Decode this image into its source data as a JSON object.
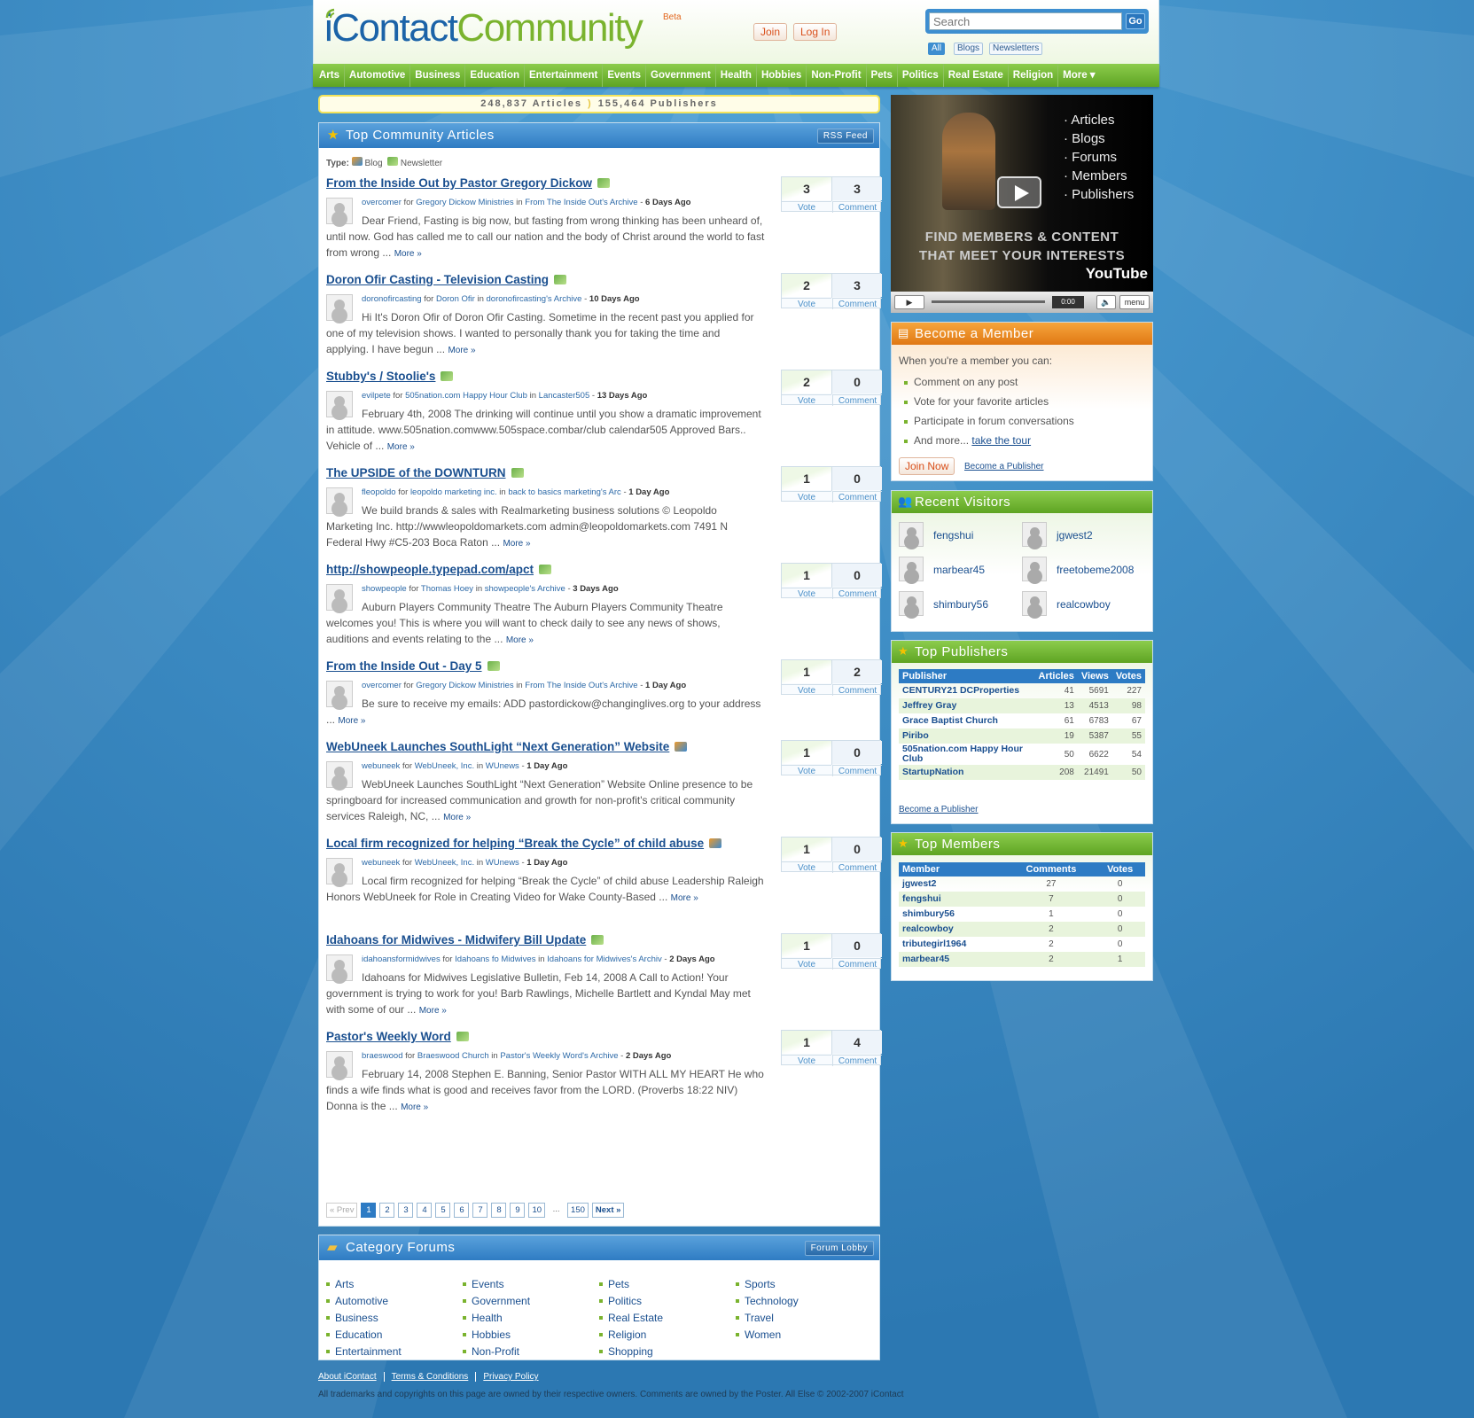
{
  "header": {
    "logo_i": "i",
    "logo_contact": "Contact",
    "logo_community": "Community",
    "beta": "Beta",
    "join": "Join",
    "login": "Log In",
    "search_placeholder": "Search",
    "go": "Go",
    "search_tabs": [
      "All",
      "Blogs",
      "Newsletters"
    ]
  },
  "nav": [
    "Arts",
    "Automotive",
    "Business",
    "Education",
    "Entertainment",
    "Events",
    "Government",
    "Health",
    "Hobbies",
    "Non-Profit",
    "Pets",
    "Politics",
    "Real Estate",
    "Religion",
    "More ▾"
  ],
  "stats": {
    "articles": "248,837 Articles",
    "publishers": "155,464 Publishers"
  },
  "top_articles": {
    "title": "Top Community Articles",
    "rss": "RSS Feed",
    "type_label": "Type:",
    "type_blog": "Blog",
    "type_newsletter": "Newsletter",
    "vote_label": "Vote",
    "comment_label": "Comment",
    "more": "More »",
    "items": [
      {
        "title": "From the Inside Out by Pastor Gregory Dickow",
        "kind": "newsletter",
        "user": "overcomer",
        "for": "Gregory Dickow Ministries",
        "in": "From The Inside Out's Archive",
        "age": "6 Days Ago",
        "excerpt": "Dear Friend, Fasting is big now, but fasting from wrong thinking has been unheard of, until now. God has called me to call our nation and the body of Christ around the world to fast from wrong ...",
        "votes": "3",
        "comments": "3"
      },
      {
        "title": "Doron Ofir Casting - Television Casting",
        "kind": "newsletter",
        "user": "doronofircasting",
        "for": "Doron Ofir",
        "in": "doronofircasting's Archive",
        "age": "10 Days Ago",
        "excerpt": "Hi It's Doron Ofir of Doron Ofir Casting. Sometime in the recent past you applied for one of my television shows. I wanted to personally thank you for taking the time and applying. I have begun ...",
        "votes": "2",
        "comments": "3"
      },
      {
        "title": "Stubby's / Stoolie's",
        "kind": "newsletter",
        "user": "evilpete",
        "for": "505nation.com Happy Hour Club",
        "in": "Lancaster505",
        "age": "13 Days Ago",
        "excerpt": "February 4th, 2008 The drinking will continue until you show a dramatic improvement in attitude.    www.505nation.comwww.505space.combar/club calendar505 Approved Bars..   Vehicle of ...",
        "votes": "2",
        "comments": "0"
      },
      {
        "title": "The UPSIDE of the DOWNTURN",
        "kind": "newsletter",
        "user": "fleopoldo",
        "for": "leopoldo marketing inc.",
        "in": "back to basics marketing's Arc",
        "age": "1 Day Ago",
        "excerpt": "We build brands & sales with Realmarketing business solutions       © Leopoldo Marketing Inc. http://wwwleopoldomarkets.com admin@leopoldomarkets.com  7491 N Federal Hwy #C5-203 Boca Raton ...",
        "votes": "1",
        "comments": "0"
      },
      {
        "title": "http://showpeople.typepad.com/apct",
        "kind": "newsletter",
        "user": "showpeople",
        "for": "Thomas Hoey",
        "in": "showpeople's Archive",
        "age": "3 Days Ago",
        "excerpt": "Auburn Players Community Theatre   The Auburn Players Community Theatre welcomes you! This is where you will want to check daily to see any news of shows, auditions and events relating to the ...",
        "votes": "1",
        "comments": "0"
      },
      {
        "title": "From the Inside Out - Day 5",
        "kind": "newsletter",
        "user": "overcomer",
        "for": "Gregory Dickow Ministries",
        "in": "From The Inside Out's Archive",
        "age": "1 Day Ago",
        "excerpt": "         Be sure to receive my emails: ADD pastordickow@changinglives.org to your address ...",
        "votes": "1",
        "comments": "2"
      },
      {
        "title": "WebUneek Launches SouthLight “Next Generation” Website",
        "kind": "blog",
        "user": "webuneek",
        "for": "WebUneek, Inc.",
        "in": "WUnews",
        "age": "1 Day Ago",
        "excerpt": "WebUneek Launches SouthLight “Next Generation” Website Online presence to be springboard for increased communication and growth for non-profit's critical community services   Raleigh, NC, ...",
        "votes": "1",
        "comments": "0"
      },
      {
        "title": "Local firm recognized for helping “Break the Cycle” of child abuse",
        "kind": "blog",
        "user": "webuneek",
        "for": "WebUneek, Inc.",
        "in": "WUnews",
        "age": "1 Day Ago",
        "excerpt": "              Local firm recognized for helping “Break the Cycle” of child abuse Leadership Raleigh Honors WebUneek for Role in Creating Video for Wake County-Based ...",
        "votes": "1",
        "comments": "0"
      },
      {
        "title": "Idahoans for Midwives - Midwifery Bill Update",
        "kind": "newsletter",
        "user": "idahoansformidwives",
        "for": "Idahoans fo Midwives",
        "in": "Idahoans for Midwives's Archiv",
        "age": "2 Days Ago",
        "excerpt": "Idahoans for Midwives Legislative Bulletin, Feb 14,  2008    A Call to Action! Your government is trying to work for you! Barb Rawlings, Michelle Bartlett and Kyndal May met with some of our ...",
        "votes": "1",
        "comments": "0"
      },
      {
        "title": "Pastor's Weekly Word",
        "kind": "newsletter",
        "user": "braeswood",
        "for": "Braeswood Church",
        "in": "Pastor's Weekly Word's Archive",
        "age": "2 Days Ago",
        "excerpt": "February 14, 2008 Stephen E. Banning, Senior Pastor  WITH ALL MY HEART He who finds a wife finds what is good and receives favor from the LORD. (Proverbs 18:22 NIV) Donna is the ...",
        "votes": "1",
        "comments": "4"
      }
    ],
    "pager": {
      "prev": "« Prev",
      "pages": [
        "1",
        "2",
        "3",
        "4",
        "5",
        "6",
        "7",
        "8",
        "9",
        "10"
      ],
      "dots": "...",
      "last": "150",
      "next": "Next »",
      "current": "1"
    }
  },
  "forums": {
    "title": "Category Forums",
    "lobby": "Forum Lobby",
    "columns": [
      [
        "Arts",
        "Automotive",
        "Business",
        "Education",
        "Entertainment"
      ],
      [
        "Events",
        "Government",
        "Health",
        "Hobbies",
        "Non-Profit"
      ],
      [
        "Pets",
        "Politics",
        "Real Estate",
        "Religion",
        "Shopping"
      ],
      [
        "Sports",
        "Technology",
        "Travel",
        "Women"
      ]
    ]
  },
  "footer": {
    "links": [
      "About iContact",
      "Terms & Conditions",
      "Privacy Policy"
    ],
    "copyright": "All trademarks and copyrights on this page are owned by their respective owners. Comments are owned by the Poster. All Else © 2002-2007 iContact"
  },
  "video": {
    "list": [
      "· Articles",
      "· Blogs",
      "· Forums",
      "· Members",
      "· Publishers"
    ],
    "tagline1": "FIND MEMBERS & CONTENT",
    "tagline2": "THAT MEET YOUR INTERESTS",
    "brand": "YouTube",
    "time": "0:00",
    "menu": "menu"
  },
  "become_member": {
    "title": "Become a Member",
    "intro": "When you're a member you can:",
    "items": [
      "Comment on any post",
      "Vote for your favorite articles",
      "Participate in forum conversations"
    ],
    "more_prefix": "And more...",
    "tour": "take the tour",
    "join_now": "Join Now",
    "become_publisher": "Become a Publisher"
  },
  "visitors": {
    "title": "Recent Visitors",
    "names": [
      "fengshui",
      "jgwest2",
      "marbear45",
      "freetobeme2008",
      "shimbury56",
      "realcowboy"
    ]
  },
  "top_publishers": {
    "title": "Top Publishers",
    "headers": [
      "Publisher",
      "Articles",
      "Views",
      "Votes"
    ],
    "rows": [
      [
        "CENTURY21 DCProperties",
        "41",
        "5691",
        "227"
      ],
      [
        "Jeffrey Gray",
        "13",
        "4513",
        "98"
      ],
      [
        "Grace Baptist Church",
        "61",
        "6783",
        "67"
      ],
      [
        "Piribo",
        "19",
        "5387",
        "55"
      ],
      [
        "505nation.com Happy Hour Club",
        "50",
        "6622",
        "54"
      ],
      [
        "StartupNation",
        "208",
        "21491",
        "50"
      ]
    ],
    "become_publisher": "Become a Publisher"
  },
  "top_members": {
    "title": "Top Members",
    "headers": [
      "Member",
      "Comments",
      "Votes"
    ],
    "rows": [
      [
        "jgwest2",
        "27",
        "0"
      ],
      [
        "fengshui",
        "7",
        "0"
      ],
      [
        "shimbury56",
        "1",
        "0"
      ],
      [
        "realcowboy",
        "2",
        "0"
      ],
      [
        "tributegirl1964",
        "2",
        "0"
      ],
      [
        "marbear45",
        "2",
        "1"
      ]
    ]
  },
  "colors": {
    "nav_green": "#6cb230",
    "header_blue": "#2f7cc3",
    "accent_orange": "#e07814",
    "bg_blue": "#3f8cc4"
  }
}
